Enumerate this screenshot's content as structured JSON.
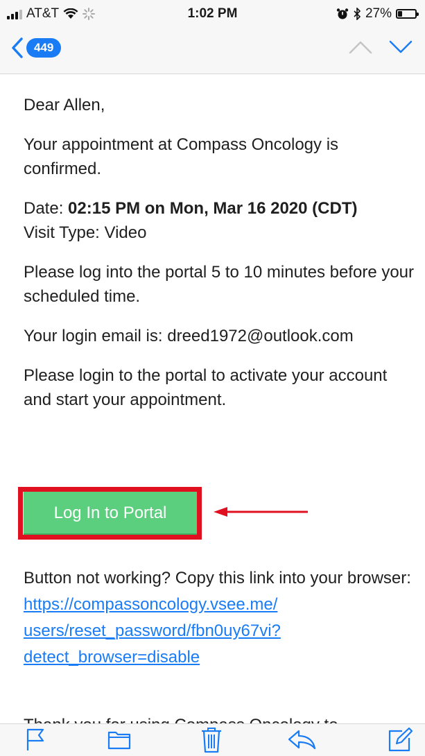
{
  "status_bar": {
    "carrier": "AT&T",
    "time": "1:02 PM",
    "battery_percent": "27%",
    "battery_level": 0.27
  },
  "nav": {
    "unread_count": "449"
  },
  "email": {
    "greeting": "Dear Allen,",
    "confirmation": "Your appointment at Compass Oncology is confirmed.",
    "date_label": "Date:",
    "date_value": "02:15 PM on Mon, Mar 16 2020 (CDT)",
    "visit_type": "Visit Type: Video",
    "instruction": "Please log into the portal 5 to 10 minutes before your scheduled time.",
    "login_email": "Your login email is: dreed1972@outlook.com",
    "activate": "Please login to the portal to activate your account and start your appointment.",
    "button_label": "Log In to Portal",
    "link_intro": "Button not working? Copy this link into your browser:",
    "link_line1": "https://compassoncology.vsee.me/",
    "link_line2": "users/reset_password/fbn0uy67vi?",
    "link_line3": "detect_browser=disable",
    "clipped_next": "Thank you for using Compass Oncology to"
  },
  "colors": {
    "accent": "#1a7cf5",
    "button": "#5ccf7f",
    "highlight": "#e01020"
  },
  "toolbar_icons": [
    "flag-icon",
    "folder-icon",
    "trash-icon",
    "reply-icon",
    "compose-icon"
  ]
}
